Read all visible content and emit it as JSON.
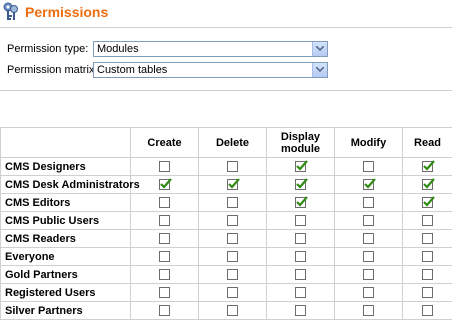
{
  "header": {
    "title": "Permissions",
    "icon": "permissions-keys-icon"
  },
  "form": {
    "permission_type_label": "Permission type:",
    "permission_type_value": "Modules",
    "permission_matrix_label": "Permission matrix:",
    "permission_matrix_value": "Custom tables"
  },
  "matrix": {
    "columns": [
      "Create",
      "Delete",
      "Display module",
      "Modify",
      "Read"
    ],
    "rows": [
      {
        "role": "CMS Designers",
        "checks": [
          false,
          false,
          true,
          false,
          true
        ]
      },
      {
        "role": "CMS Desk Administrators",
        "checks": [
          true,
          true,
          true,
          true,
          true
        ]
      },
      {
        "role": "CMS Editors",
        "checks": [
          false,
          false,
          true,
          false,
          true
        ]
      },
      {
        "role": "CMS Public Users",
        "checks": [
          false,
          false,
          false,
          false,
          false
        ]
      },
      {
        "role": "CMS Readers",
        "checks": [
          false,
          false,
          false,
          false,
          false
        ]
      },
      {
        "role": "Everyone",
        "checks": [
          false,
          false,
          false,
          false,
          false
        ]
      },
      {
        "role": "Gold Partners",
        "checks": [
          false,
          false,
          false,
          false,
          false
        ]
      },
      {
        "role": "Registered Users",
        "checks": [
          false,
          false,
          false,
          false,
          false
        ]
      },
      {
        "role": "Silver Partners",
        "checks": [
          false,
          false,
          false,
          false,
          false
        ]
      }
    ]
  },
  "colors": {
    "title": "#ee6d10",
    "check": "#2e8b12"
  }
}
